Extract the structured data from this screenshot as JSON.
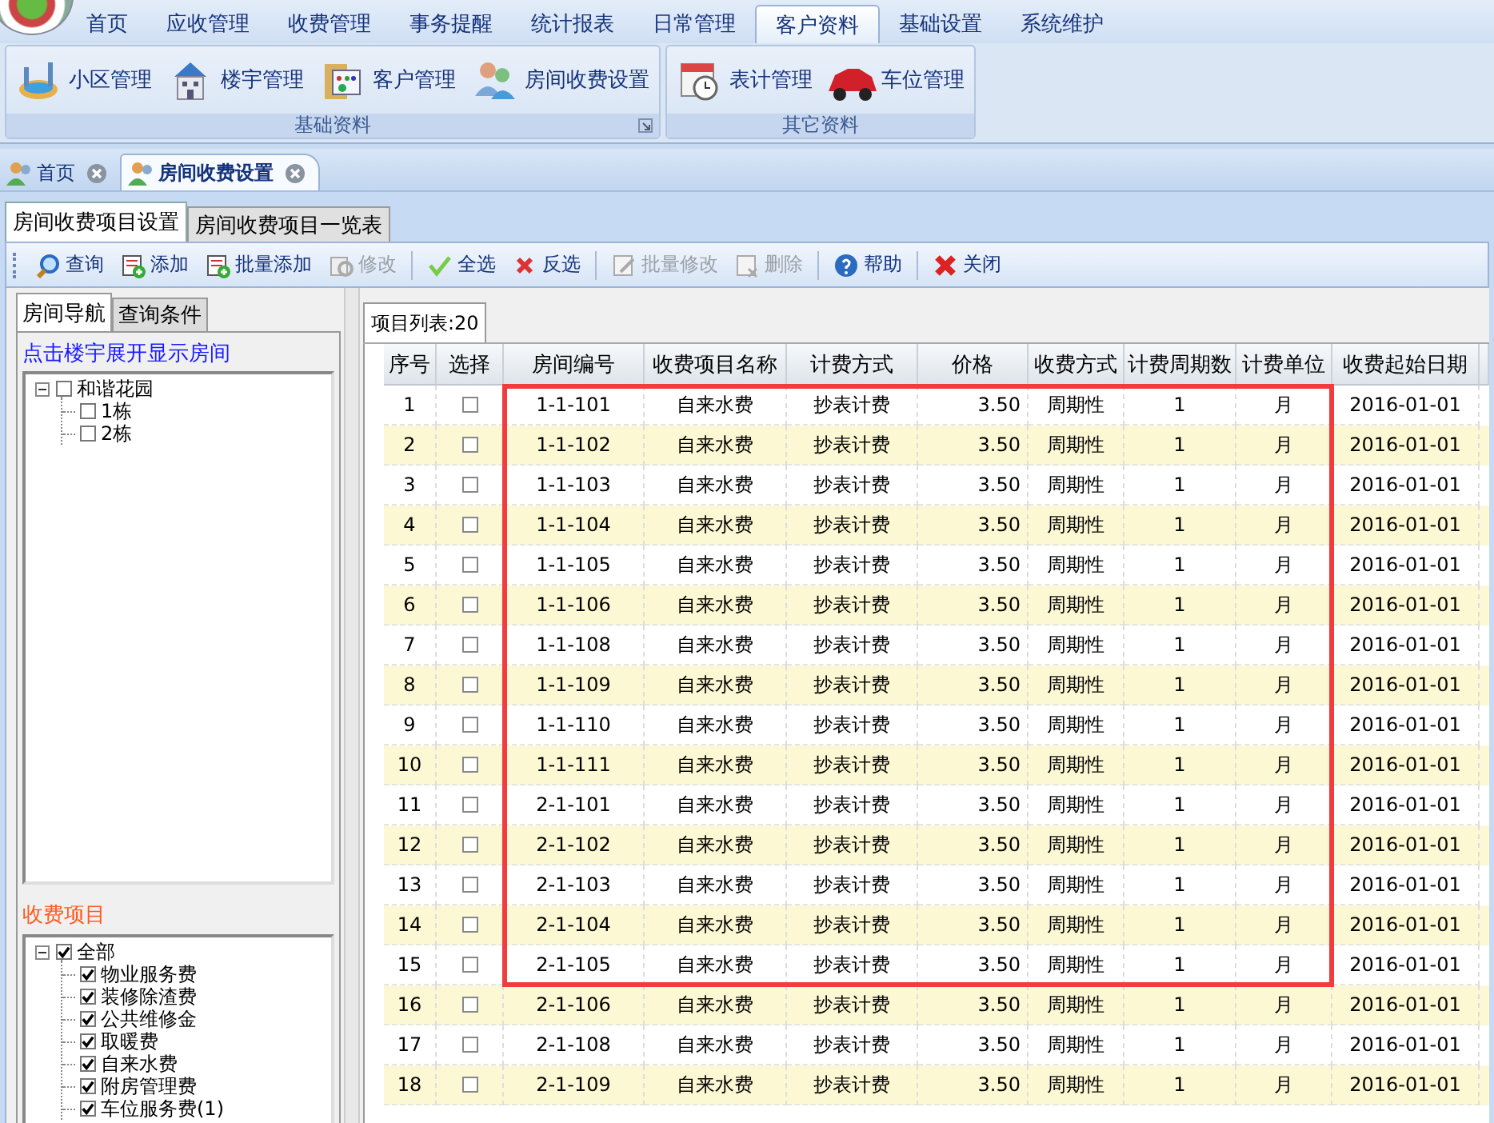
{
  "menu_tabs": [
    {
      "label": "首页",
      "selected": false
    },
    {
      "label": "应收管理",
      "selected": false
    },
    {
      "label": "收费管理",
      "selected": false
    },
    {
      "label": "事务提醒",
      "selected": false
    },
    {
      "label": "统计报表",
      "selected": false
    },
    {
      "label": "日常管理",
      "selected": false
    },
    {
      "label": "客户资料",
      "selected": true
    },
    {
      "label": "基础设置",
      "selected": false
    },
    {
      "label": "系统维护",
      "selected": false
    }
  ],
  "ribbon": {
    "groups": [
      {
        "title": "基础资料",
        "items": [
          "小区管理",
          "楼宇管理",
          "客户管理",
          "房间收费设置"
        ]
      },
      {
        "title": "其它资料",
        "items": [
          "表计管理",
          "车位管理"
        ]
      }
    ]
  },
  "doc_tabs": [
    {
      "label": "首页",
      "selected": false
    },
    {
      "label": "房间收费设置",
      "selected": true
    }
  ],
  "sub_tabs": [
    {
      "label": "房间收费项目设置",
      "selected": true
    },
    {
      "label": "房间收费项目一览表",
      "selected": false
    }
  ],
  "toolbar": {
    "groups": [
      [
        {
          "label": "查询",
          "disabled": false
        },
        {
          "label": "添加",
          "disabled": false
        },
        {
          "label": "批量添加",
          "disabled": false
        },
        {
          "label": "修改",
          "disabled": true
        }
      ],
      [
        {
          "label": "全选",
          "disabled": false
        },
        {
          "label": "反选",
          "disabled": false
        }
      ],
      [
        {
          "label": "批量修改",
          "disabled": true
        },
        {
          "label": "删除",
          "disabled": true
        }
      ],
      [
        {
          "label": "帮助",
          "disabled": false
        }
      ],
      [
        {
          "label": "关闭",
          "disabled": false
        }
      ]
    ]
  },
  "left_tabs": [
    {
      "label": "房间导航",
      "selected": true
    },
    {
      "label": "查询条件",
      "selected": false
    }
  ],
  "room_hint": "点击楼宇展开显示房间",
  "room_tree": {
    "label": "和谐花园",
    "checked": false,
    "expanded": true,
    "children": [
      {
        "label": "1栋",
        "checked": false
      },
      {
        "label": "2栋",
        "checked": false
      }
    ]
  },
  "fee_title": "收费项目",
  "fee_tree": {
    "label": "全部",
    "checked": true,
    "expanded": true,
    "children": [
      {
        "label": "物业服务费",
        "checked": true
      },
      {
        "label": "装修除渣费",
        "checked": true
      },
      {
        "label": "公共维修金",
        "checked": true
      },
      {
        "label": "取暖费",
        "checked": true
      },
      {
        "label": "自来水费",
        "checked": true
      },
      {
        "label": "附房管理费",
        "checked": true
      },
      {
        "label": "车位服务费(1)",
        "checked": true
      }
    ]
  },
  "list_tab": "项目列表:20",
  "table": {
    "columns": [
      "序号",
      "选择",
      "房间编号",
      "收费项目名称",
      "计费方式",
      "价格",
      "收费方式",
      "计费周期数",
      "计费单位",
      "收费起始日期"
    ],
    "rows": [
      {
        "selected": false,
        "cells": [
          "1",
          "",
          "1-1-101",
          "自来水费",
          "抄表计费",
          "3.50",
          "周期性",
          "1",
          "月",
          "2016-01-01"
        ]
      },
      {
        "selected": false,
        "cells": [
          "2",
          "",
          "1-1-102",
          "自来水费",
          "抄表计费",
          "3.50",
          "周期性",
          "1",
          "月",
          "2016-01-01"
        ]
      },
      {
        "selected": false,
        "cells": [
          "3",
          "",
          "1-1-103",
          "自来水费",
          "抄表计费",
          "3.50",
          "周期性",
          "1",
          "月",
          "2016-01-01"
        ]
      },
      {
        "selected": false,
        "cells": [
          "4",
          "",
          "1-1-104",
          "自来水费",
          "抄表计费",
          "3.50",
          "周期性",
          "1",
          "月",
          "2016-01-01"
        ]
      },
      {
        "selected": false,
        "cells": [
          "5",
          "",
          "1-1-105",
          "自来水费",
          "抄表计费",
          "3.50",
          "周期性",
          "1",
          "月",
          "2016-01-01"
        ]
      },
      {
        "selected": false,
        "cells": [
          "6",
          "",
          "1-1-106",
          "自来水费",
          "抄表计费",
          "3.50",
          "周期性",
          "1",
          "月",
          "2016-01-01"
        ]
      },
      {
        "selected": false,
        "cells": [
          "7",
          "",
          "1-1-108",
          "自来水费",
          "抄表计费",
          "3.50",
          "周期性",
          "1",
          "月",
          "2016-01-01"
        ]
      },
      {
        "selected": false,
        "cells": [
          "8",
          "",
          "1-1-109",
          "自来水费",
          "抄表计费",
          "3.50",
          "周期性",
          "1",
          "月",
          "2016-01-01"
        ]
      },
      {
        "selected": false,
        "cells": [
          "9",
          "",
          "1-1-110",
          "自来水费",
          "抄表计费",
          "3.50",
          "周期性",
          "1",
          "月",
          "2016-01-01"
        ]
      },
      {
        "selected": false,
        "cells": [
          "10",
          "",
          "1-1-111",
          "自来水费",
          "抄表计费",
          "3.50",
          "周期性",
          "1",
          "月",
          "2016-01-01"
        ]
      },
      {
        "selected": false,
        "cells": [
          "11",
          "",
          "2-1-101",
          "自来水费",
          "抄表计费",
          "3.50",
          "周期性",
          "1",
          "月",
          "2016-01-01"
        ]
      },
      {
        "selected": false,
        "cells": [
          "12",
          "",
          "2-1-102",
          "自来水费",
          "抄表计费",
          "3.50",
          "周期性",
          "1",
          "月",
          "2016-01-01"
        ]
      },
      {
        "selected": false,
        "cells": [
          "13",
          "",
          "2-1-103",
          "自来水费",
          "抄表计费",
          "3.50",
          "周期性",
          "1",
          "月",
          "2016-01-01"
        ]
      },
      {
        "selected": false,
        "cells": [
          "14",
          "",
          "2-1-104",
          "自来水费",
          "抄表计费",
          "3.50",
          "周期性",
          "1",
          "月",
          "2016-01-01"
        ]
      },
      {
        "selected": false,
        "cells": [
          "15",
          "",
          "2-1-105",
          "自来水费",
          "抄表计费",
          "3.50",
          "周期性",
          "1",
          "月",
          "2016-01-01"
        ]
      },
      {
        "selected": false,
        "cells": [
          "16",
          "",
          "2-1-106",
          "自来水费",
          "抄表计费",
          "3.50",
          "周期性",
          "1",
          "月",
          "2016-01-01"
        ]
      },
      {
        "selected": false,
        "cells": [
          "17",
          "",
          "2-1-108",
          "自来水费",
          "抄表计费",
          "3.50",
          "周期性",
          "1",
          "月",
          "2016-01-01"
        ]
      },
      {
        "selected": false,
        "cells": [
          "18",
          "",
          "2-1-109",
          "自来水费",
          "抄表计费",
          "3.50",
          "周期性",
          "1",
          "月",
          "2016-01-01"
        ]
      }
    ]
  }
}
